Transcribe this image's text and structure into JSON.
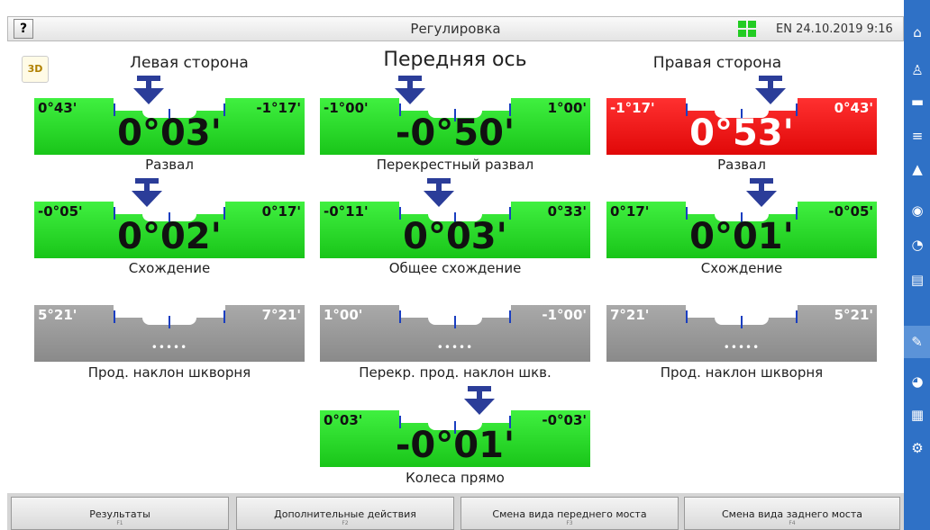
{
  "topbar": {
    "help_label": "?",
    "title": "Регулировка",
    "status_text": "EN 24.10.2019 9:16"
  },
  "logo_text": "3D",
  "headers": {
    "left": "Левая сторона",
    "center": "Передняя ось",
    "right": "Правая сторона"
  },
  "gauges": {
    "left_camber": {
      "left": "0°43'",
      "right": "-1°17'",
      "value": "0°03'",
      "caption": "Развал",
      "state": "ok"
    },
    "cross_camber": {
      "left": "-1°00'",
      "right": "1°00'",
      "value": "-0°50'",
      "caption": "Перекрестный развал",
      "state": "ok"
    },
    "right_camber": {
      "left": "-1°17'",
      "right": "0°43'",
      "value": "0°53'",
      "caption": "Развал",
      "state": "out_of_tolerance"
    },
    "left_toe": {
      "left": "-0°05'",
      "right": "0°17'",
      "value": "0°02'",
      "caption": "Схождение",
      "state": "ok"
    },
    "total_toe": {
      "left": "-0°11'",
      "right": "0°33'",
      "value": "0°03'",
      "caption": "Общее схождение",
      "state": "ok"
    },
    "right_toe": {
      "left": "0°17'",
      "right": "-0°05'",
      "value": "0°01'",
      "caption": "Схождение",
      "state": "ok"
    },
    "left_caster": {
      "left": "5°21'",
      "right": "7°21'",
      "value": "•••••",
      "caption": "Прод. наклон шкворня",
      "state": "not_measured"
    },
    "cross_caster": {
      "left": "1°00'",
      "right": "-1°00'",
      "value": "•••••",
      "caption": "Перекр. прод. наклон шкв.",
      "state": "not_measured"
    },
    "right_caster": {
      "left": "7°21'",
      "right": "5°21'",
      "value": "•••••",
      "caption": "Прод. наклон шкворня",
      "state": "not_measured"
    },
    "straight": {
      "left": "0°03'",
      "right": "-0°03'",
      "value": "-0°01'",
      "caption": "Колеса прямо",
      "state": "ok"
    }
  },
  "colors": {
    "ok": "#22dd22",
    "out_of_tolerance": "#f01010",
    "not_measured": "#999999",
    "pointer": "#2b3d99",
    "sidebar": "#2f71c6"
  },
  "sidebar_icons": [
    "home-icon",
    "user-icon",
    "car-icon",
    "list-icon",
    "image-icon",
    "target-icon",
    "gauge-icon",
    "clipboard-icon",
    "wrench-icon",
    "adjust-icon",
    "report-icon",
    "settings-icon"
  ],
  "bottom_buttons": [
    {
      "label": "Результаты",
      "key": "F1"
    },
    {
      "label": "Дополнительные действия",
      "key": "F2"
    },
    {
      "label": "Смена вида переднего моста",
      "key": "F3"
    },
    {
      "label": "Смена вида заднего моста",
      "key": "F4"
    }
  ]
}
